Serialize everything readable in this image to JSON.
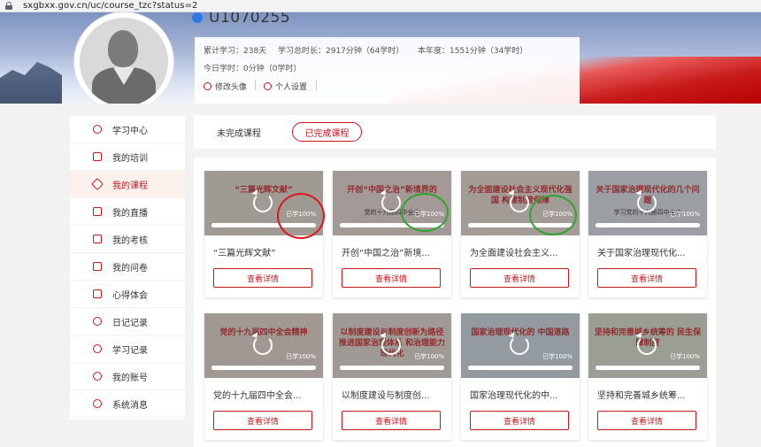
{
  "browser": {
    "url": "sxgbxx.gov.cn/uc/course_tzc?status=2"
  },
  "user": {
    "id": "U1070255",
    "stats_line1": {
      "total_days": "累计学习：238天",
      "total_time": "学习总时长：2917分钟（64学时）",
      "year": "本年度：1551分钟（34学时）"
    },
    "today": "今日学时：0分钟（0学时）",
    "edit_avatar": "修改头像",
    "settings": "个人设置"
  },
  "sidebar": {
    "items": [
      {
        "label": "学习中心",
        "icon": "person-icon"
      },
      {
        "label": "我的培训",
        "icon": "bus-icon"
      },
      {
        "label": "我的课程",
        "icon": "tag-icon",
        "active": true
      },
      {
        "label": "我的直播",
        "icon": "live-icon"
      },
      {
        "label": "我的考核",
        "icon": "doc-icon"
      },
      {
        "label": "我的问卷",
        "icon": "survey-icon"
      },
      {
        "label": "心得体会",
        "icon": "edit-icon"
      },
      {
        "label": "日记记录",
        "icon": "question-icon"
      },
      {
        "label": "学习记录",
        "icon": "history-icon"
      },
      {
        "label": "我的账号",
        "icon": "account-icon"
      },
      {
        "label": "系统消息",
        "icon": "message-icon"
      }
    ]
  },
  "tabs": {
    "incomplete": "未完成课程",
    "complete": "已完成课程"
  },
  "courses": [
    {
      "title": "“三篇光辉文献”",
      "thumb": "“三篇光辉文献”",
      "progress_label": "已学100%",
      "progress": 1.0,
      "button": "查看详情",
      "bg": "#f3e7df"
    },
    {
      "title": "开创“中国之治”新境...",
      "thumb": "开创“中国之治”新境界的",
      "sub": "党的十九届四中全会",
      "progress_label": "已学100%",
      "progress": 1.0,
      "button": "查看详情",
      "bg": "#f7e6e2"
    },
    {
      "title": "为全面建设社会主义...",
      "thumb": "为全面建设社会主义现代化强国 构建制度保障",
      "progress_label": "已学100%",
      "progress": 1.0,
      "button": "查看详情",
      "bg": "#f8e9e0"
    },
    {
      "title": "关于国家治理现代化...",
      "thumb": "关于国家治理现代化的几个问题",
      "sub": "学习党的十九届四中全会",
      "progress_label": "已学100%",
      "progress": 1.0,
      "button": "查看详情",
      "bg": "#e9eef6"
    },
    {
      "title": "党的十九届四中全会...",
      "thumb": "党的十九届四中全会精神",
      "progress_label": "已学100%",
      "progress": 1.0,
      "button": "查看详情",
      "bg": "#f4e4dc"
    },
    {
      "title": "以制度建设与制度创...",
      "thumb": "以制度建设与制度创新为路径 推进国家治理体系 和治理能力现代化",
      "progress_label": "已学100%",
      "progress": 1.0,
      "button": "查看详情",
      "bg": "#f2e8e2"
    },
    {
      "title": "国家治理现代化的中...",
      "thumb": "国家治理现代化的 中国道路",
      "progress_label": "已学100%",
      "progress": 1.0,
      "button": "查看详情",
      "bg": "#dde9f2"
    },
    {
      "title": "坚持和完善城乡统筹...",
      "thumb": "坚持和完善城乡统筹的 民生保障制度",
      "progress_label": "已学100%",
      "progress": 1.0,
      "button": "查看详情",
      "bg": "#e7efdf"
    }
  ],
  "colors": {
    "accent": "#c8161d",
    "mark_red": "#e0161d",
    "mark_green": "#2fa52f"
  }
}
